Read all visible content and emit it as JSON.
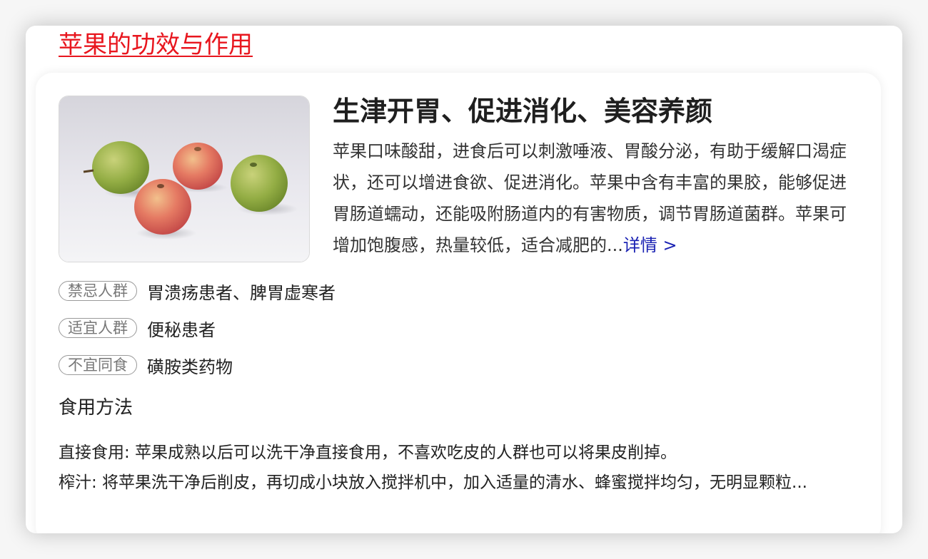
{
  "result": {
    "title": "苹果的功效与作用"
  },
  "card": {
    "image_alt": "apples-photo",
    "headline": "生津开胃、促进消化、美容养颜",
    "summary": "苹果口味酸甜，进食后可以刺激唾液、胃酸分泌，有助于缓解口渴症状，还可以增进食欲、促进消化。苹果中含有丰富的果胶，能够促进胃肠道蠕动，还能吸附肠道内的有害物质，调节胃肠道菌群。苹果可增加饱腹感，热量较低，适合减肥的...",
    "more_label": "详情 >",
    "tags": [
      {
        "label": "禁忌人群",
        "value": "胃溃疡患者、脾胃虚寒者"
      },
      {
        "label": "适宜人群",
        "value": "便秘患者"
      },
      {
        "label": "不宜同食",
        "value": "磺胺类药物"
      }
    ],
    "method_title": "食用方法",
    "methods": [
      "直接食用: 苹果成熟以后可以洗干净直接食用，不喜欢吃皮的人群也可以将果皮削掉。",
      "榨汁: 将苹果洗干净后削皮，再切成小块放入搅拌机中，加入适量的清水、蜂蜜搅拌均匀，无明显颗粒..."
    ]
  },
  "colors": {
    "title_link": "#e8161e",
    "more_link": "#1a22b3",
    "tag_border": "#9a9a9a",
    "tag_text": "#777777"
  }
}
